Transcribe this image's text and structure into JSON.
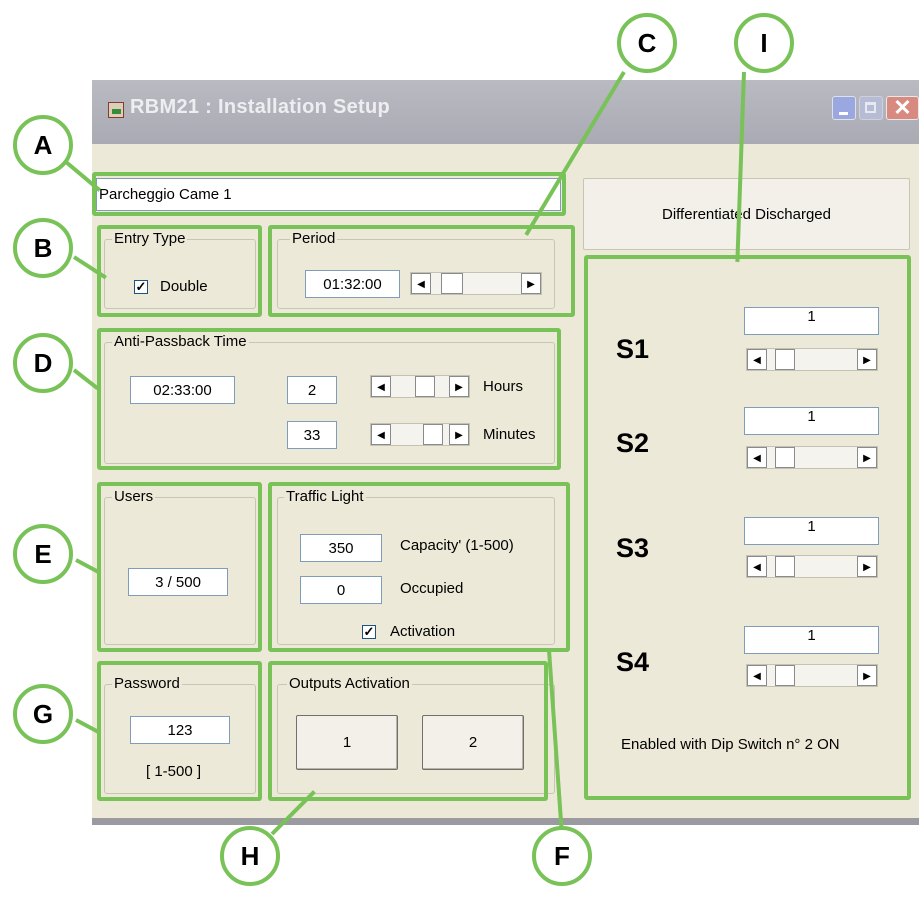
{
  "window": {
    "title": "RBM21 : Installation Setup",
    "close_glyph": "✕"
  },
  "installation_name": "Parcheggio Came 1",
  "entry_type": {
    "legend": "Entry Type",
    "double_label": "Double",
    "double_checked": true
  },
  "period": {
    "legend": "Period",
    "value": "01:32:00"
  },
  "anti_passback": {
    "legend": "Anti-Passback Time",
    "value": "02:33:00",
    "hours": "2",
    "hours_label": "Hours",
    "minutes": "33",
    "minutes_label": "Minutes"
  },
  "users": {
    "legend": "Users",
    "value": "3 / 500"
  },
  "traffic_light": {
    "legend": "Traffic Light",
    "capacity": "350",
    "capacity_label": "Capacity' (1-500)",
    "occupied": "0",
    "occupied_label": "Occupied",
    "activation_label": "Activation",
    "activation_checked": true
  },
  "password": {
    "legend": "Password",
    "value": "123",
    "range": "[ 1-500 ]"
  },
  "outputs": {
    "legend": "Outputs Activation",
    "button1": "1",
    "button2": "2"
  },
  "discharge": {
    "button_label": "Differentiated Discharged",
    "slots": [
      {
        "label": "S1",
        "value": "1"
      },
      {
        "label": "S2",
        "value": "1"
      },
      {
        "label": "S3",
        "value": "1"
      },
      {
        "label": "S4",
        "value": "1"
      }
    ],
    "note": "Enabled with Dip Switch n° 2 ON"
  },
  "callouts": {
    "A": "A",
    "B": "B",
    "C": "C",
    "D": "D",
    "E": "E",
    "F": "F",
    "G": "G",
    "H": "H",
    "I": "I"
  },
  "colors": {
    "callout": "#78c258",
    "dialog": "#ece9d8",
    "titlebar": "#a9aab3"
  }
}
